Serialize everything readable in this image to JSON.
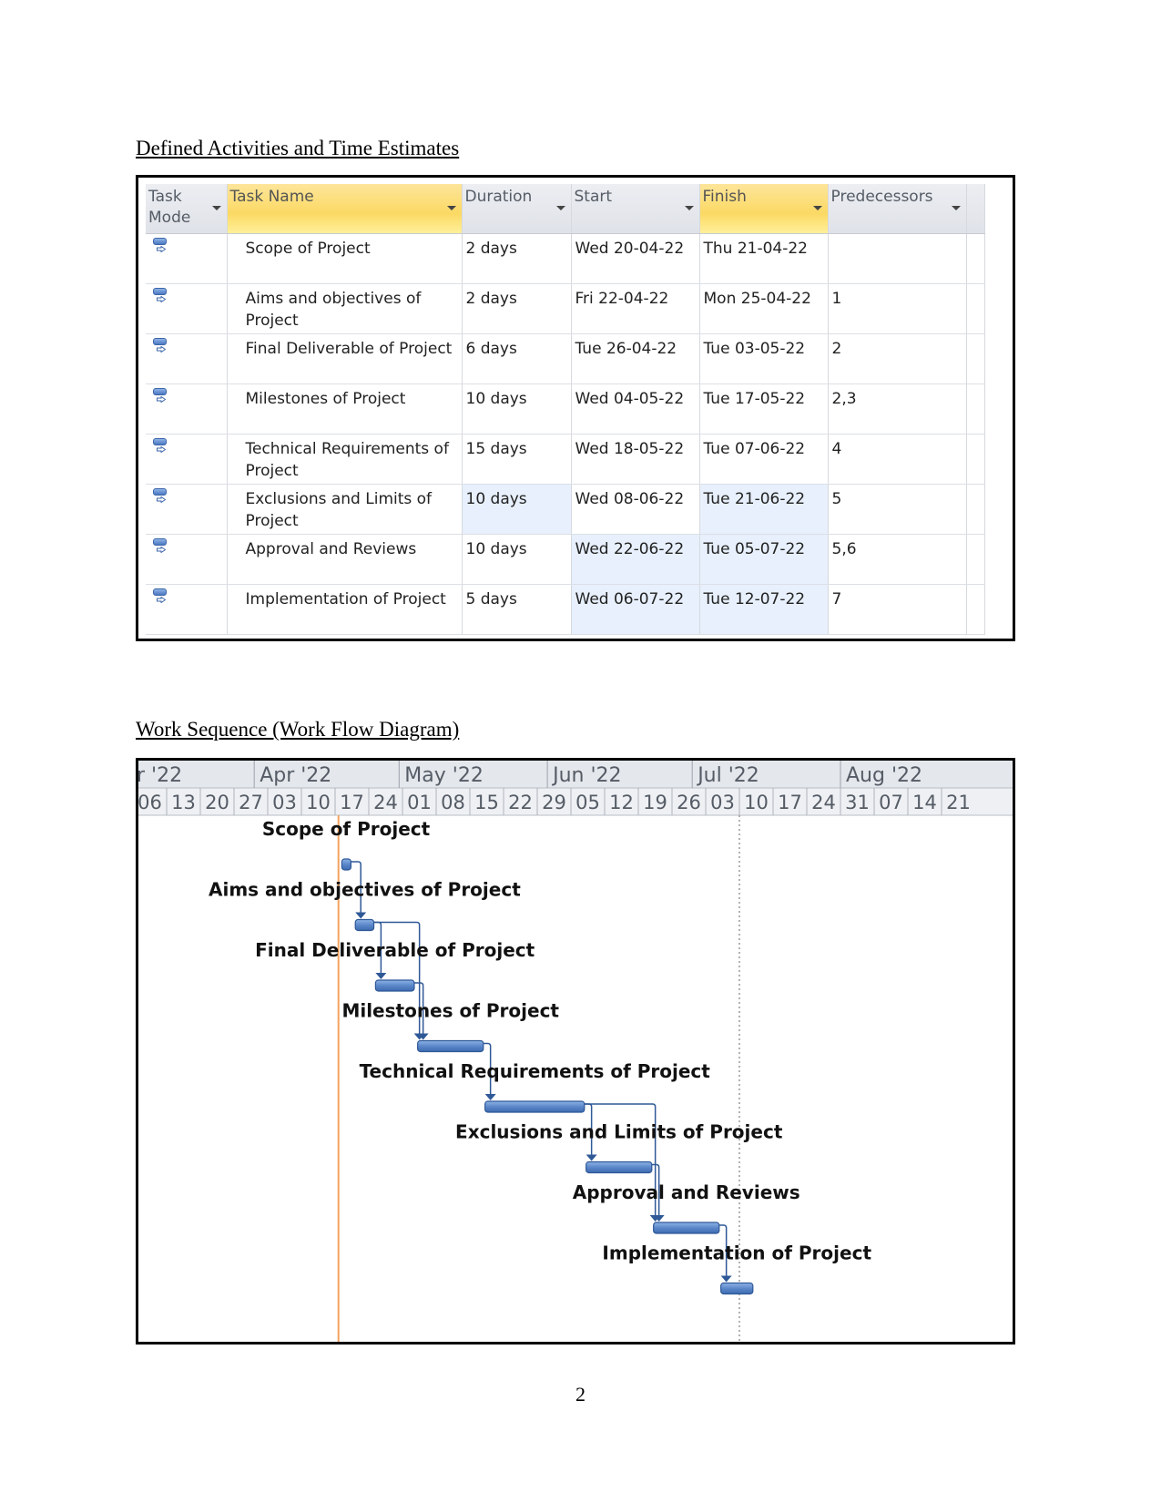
{
  "sections": {
    "activities_heading": "Defined Activities and Time Estimates",
    "workflow_heading": "Work Sequence (Work Flow Diagram)"
  },
  "table": {
    "columns": [
      {
        "label": "Task Mode",
        "line1": "Task",
        "line2": "Mode",
        "highlighted": false
      },
      {
        "label": "Task Name",
        "highlighted": true
      },
      {
        "label": "Duration",
        "highlighted": false
      },
      {
        "label": "Start",
        "highlighted": false
      },
      {
        "label": "Finish",
        "highlighted": true
      },
      {
        "label": "Predecessors",
        "highlighted": false
      }
    ],
    "rows": [
      {
        "mode_icon": "auto-scheduled-task-icon",
        "name_l1": "Scope of Project",
        "name_l2": "",
        "duration": "2 days",
        "start": "Wed 20-04-22",
        "finish": "Thu 21-04-22",
        "predecessors": ""
      },
      {
        "mode_icon": "auto-scheduled-task-icon",
        "name_l1": "Aims and objectives of",
        "name_l2": "Project",
        "duration": "2 days",
        "start": "Fri 22-04-22",
        "finish": "Mon 25-04-22",
        "predecessors": "1"
      },
      {
        "mode_icon": "auto-scheduled-task-icon",
        "name_l1": "Final Deliverable of Project",
        "name_l2": "",
        "duration": "6 days",
        "start": "Tue 26-04-22",
        "finish": "Tue 03-05-22",
        "predecessors": "2"
      },
      {
        "mode_icon": "auto-scheduled-task-icon",
        "name_l1": "Milestones of Project",
        "name_l2": "",
        "duration": "10 days",
        "start": "Wed 04-05-22",
        "finish": "Tue 17-05-22",
        "predecessors": "2,3"
      },
      {
        "mode_icon": "auto-scheduled-task-icon",
        "name_l1": "Technical Requirements of",
        "name_l2": "Project",
        "duration": "15 days",
        "start": "Wed 18-05-22",
        "finish": "Tue 07-06-22",
        "predecessors": "4"
      },
      {
        "mode_icon": "auto-scheduled-task-icon",
        "name_l1": "Exclusions and Limits of",
        "name_l2": "Project",
        "duration": "10 days",
        "start": "Wed 08-06-22",
        "finish": "Tue 21-06-22",
        "predecessors": "5"
      },
      {
        "mode_icon": "auto-scheduled-task-icon",
        "name_l1": "Approval and Reviews",
        "name_l2": "",
        "duration": "10 days",
        "start": "Wed 22-06-22",
        "finish": "Tue 05-07-22",
        "predecessors": "5,6"
      },
      {
        "mode_icon": "auto-scheduled-task-icon",
        "name_l1": "Implementation of Project",
        "name_l2": "",
        "duration": "5 days",
        "start": "Wed 06-07-22",
        "finish": "Tue 12-07-22",
        "predecessors": "7"
      }
    ],
    "shaded_cells": [
      [
        5,
        "duration"
      ],
      [
        5,
        "finish"
      ],
      [
        6,
        "start"
      ],
      [
        6,
        "finish"
      ],
      [
        7,
        "start"
      ],
      [
        7,
        "finish"
      ]
    ]
  },
  "gantt": {
    "months": [
      {
        "label": "r '22",
        "start_week": 0
      },
      {
        "label": "Apr '22",
        "start_week": 3.6
      },
      {
        "label": "May '22",
        "start_week": 7.9
      },
      {
        "label": "Jun '22",
        "start_week": 12.3
      },
      {
        "label": "Jul '22",
        "start_week": 16.6
      },
      {
        "label": "Aug '22",
        "start_week": 21.0
      }
    ],
    "weeks": [
      "06",
      "13",
      "20",
      "27",
      "03",
      "10",
      "17",
      "24",
      "01",
      "08",
      "15",
      "22",
      "29",
      "05",
      "12",
      "19",
      "26",
      "03",
      "10",
      "17",
      "24",
      "31",
      "07",
      "14",
      "21"
    ],
    "today_week": 6.1,
    "status_week": 18.0,
    "tasks": [
      {
        "label": "Scope of Project",
        "start_week": 6.2,
        "end_week": 6.45,
        "preds": []
      },
      {
        "label": "Aims and objectives of Project",
        "start_week": 6.6,
        "end_week": 7.15,
        "preds": [
          0
        ]
      },
      {
        "label": "Final Deliverable of Project",
        "start_week": 7.2,
        "end_week": 8.35,
        "preds": [
          1
        ]
      },
      {
        "label": "Milestones of Project",
        "start_week": 8.45,
        "end_week": 10.4,
        "preds": [
          1,
          2
        ]
      },
      {
        "label": "Technical Requirements of Project",
        "start_week": 10.45,
        "end_week": 13.4,
        "preds": [
          3
        ]
      },
      {
        "label": "Exclusions and Limits of Project",
        "start_week": 13.45,
        "end_week": 15.4,
        "preds": [
          4
        ]
      },
      {
        "label": "Approval and Reviews",
        "start_week": 15.45,
        "end_week": 17.4,
        "preds": [
          4,
          5
        ]
      },
      {
        "label": "Implementation of Project",
        "start_week": 17.45,
        "end_week": 18.4,
        "preds": [
          6
        ]
      }
    ],
    "colors": {
      "bar": "#5b87c9",
      "bar_dark": "#2f5897",
      "link": "#2f5897",
      "today": "#f4a460",
      "header_bg": "#e4e7ec"
    }
  },
  "page": {
    "number": "2"
  }
}
